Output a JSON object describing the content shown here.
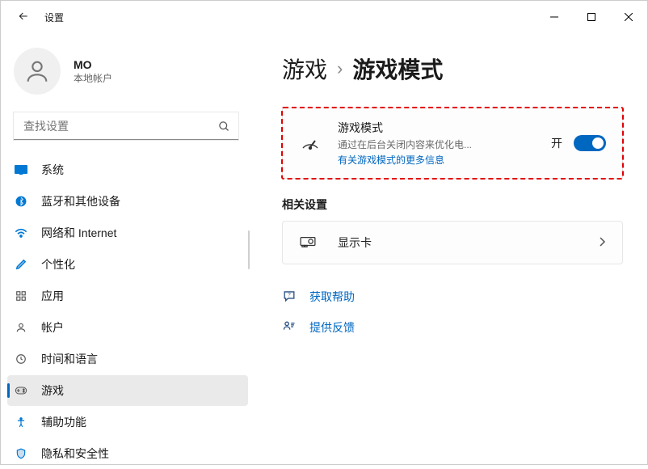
{
  "window": {
    "title": "设置"
  },
  "user": {
    "name": "MO",
    "type": "本地帐户"
  },
  "search": {
    "placeholder": "查找设置"
  },
  "nav": {
    "items": [
      {
        "label": "系统"
      },
      {
        "label": "蓝牙和其他设备"
      },
      {
        "label": "网络和 Internet"
      },
      {
        "label": "个性化"
      },
      {
        "label": "应用"
      },
      {
        "label": "帐户"
      },
      {
        "label": "时间和语言"
      },
      {
        "label": "游戏"
      },
      {
        "label": "辅助功能"
      },
      {
        "label": "隐私和安全性"
      }
    ],
    "active_index": 7
  },
  "breadcrumb": {
    "parent": "游戏",
    "sep": "›",
    "current": "游戏模式"
  },
  "game_mode": {
    "title": "游戏模式",
    "desc": "通过在后台关闭内容来优化电...",
    "more_link": "有关游戏模式的更多信息",
    "state_label": "开",
    "on": true
  },
  "related": {
    "title": "相关设置",
    "display_card": "显示卡"
  },
  "links": {
    "help": "获取帮助",
    "feedback": "提供反馈"
  }
}
